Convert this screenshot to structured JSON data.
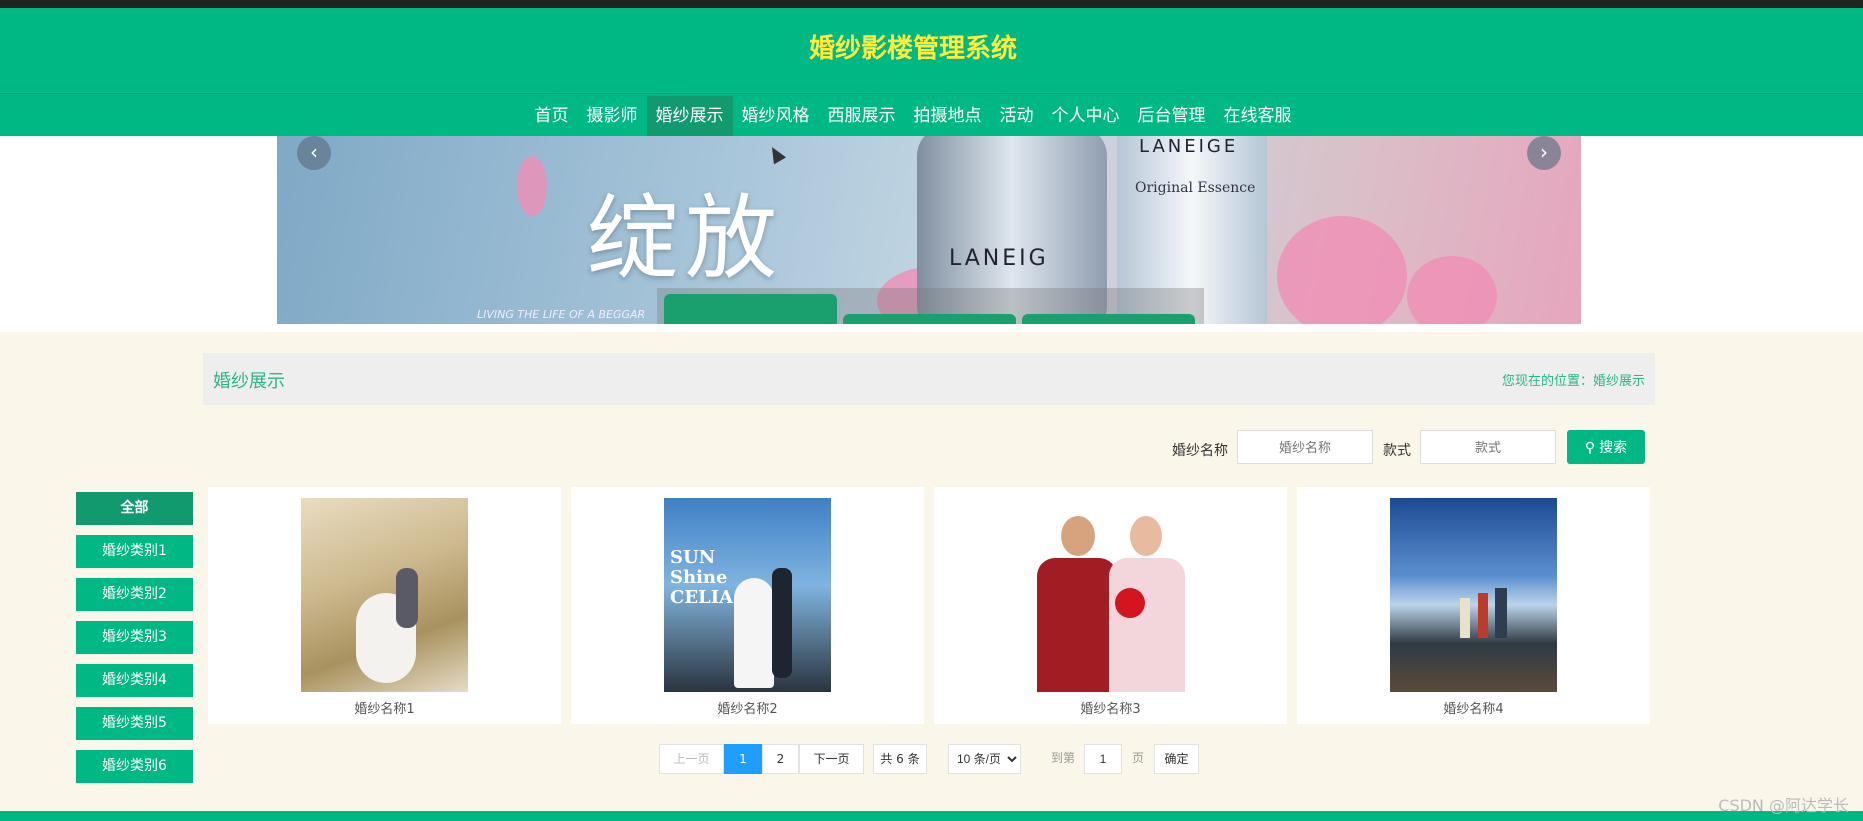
{
  "header": {
    "title": "婚纱影楼管理系统"
  },
  "nav": {
    "items": [
      "首页",
      "摄影师",
      "婚纱展示",
      "婚纱风格",
      "西服展示",
      "拍摄地点",
      "活动",
      "个人中心",
      "后台管理",
      "在线客服"
    ],
    "active_index": 2
  },
  "banner": {
    "headline": "绽放",
    "subline": "LIVING THE LIFE OF A BEGGAR",
    "brand": "LANEIG",
    "brand2": "LANEIGE",
    "brand2_sub": "Original Essence",
    "prev_label": "‹",
    "next_label": "›"
  },
  "panel": {
    "title": "婚纱展示",
    "breadcrumb": "您现在的位置：婚纱展示"
  },
  "search": {
    "name_label": "婚纱名称",
    "name_placeholder": "婚纱名称",
    "style_label": "款式",
    "style_placeholder": "款式",
    "button_label": "搜索"
  },
  "categories": [
    "全部",
    "婚纱类别1",
    "婚纱类别2",
    "婚纱类别3",
    "婚纱类别4",
    "婚纱类别5",
    "婚纱类别6"
  ],
  "products": [
    {
      "name": "婚纱名称1"
    },
    {
      "name": "婚纱名称2",
      "photo_text": "SUN Shine CELIA"
    },
    {
      "name": "婚纱名称3"
    },
    {
      "name": "婚纱名称4"
    }
  ],
  "pager": {
    "prev": "上一页",
    "pages": [
      "1",
      "2"
    ],
    "current": "1",
    "next": "下一页",
    "total": "共 6 条",
    "page_size": "10 条/页",
    "goto_label": "到第",
    "goto_value": "1",
    "page_unit": "页",
    "confirm": "确定"
  },
  "watermark": "CSDN @阿达学长",
  "colors": {
    "primary": "#00b883",
    "title": "#ffeb3b",
    "active": "#109a6e",
    "pager_current": "#1e9fff"
  }
}
